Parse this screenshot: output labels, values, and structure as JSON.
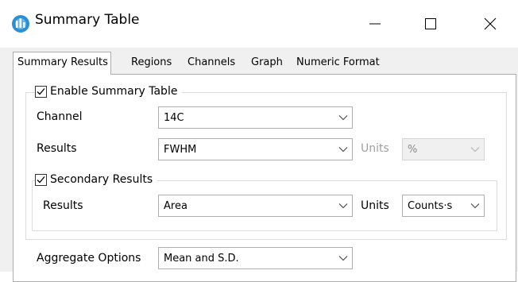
{
  "window": {
    "title": "Summary Table",
    "minimize_icon": "minimize-icon",
    "maximize_icon": "maximize-icon",
    "close_icon": "close-icon"
  },
  "tabs": [
    {
      "label": "Summary Results",
      "active": true
    },
    {
      "label": "Regions",
      "active": false
    },
    {
      "label": "Channels",
      "active": false
    },
    {
      "label": "Graph",
      "active": false
    },
    {
      "label": "Numeric Format",
      "active": false
    }
  ],
  "summary": {
    "enable_label": "Enable Summary Table",
    "enable_checked": true,
    "channel_label": "Channel",
    "channel_value": "14C",
    "results_label": "Results",
    "results_value": "FWHM",
    "units_label": "Units",
    "units_value": "%",
    "units_enabled": false
  },
  "secondary": {
    "label": "Secondary Results",
    "checked": true,
    "results_label": "Results",
    "results_value": "Area",
    "units_label": "Units",
    "units_value": "Counts·s"
  },
  "aggregate": {
    "label": "Aggregate Options",
    "value": "Mean and S.D."
  },
  "colors": {
    "accent": "#1e7fc6",
    "border": "#adadad",
    "disabled_text": "#a0a0a0"
  }
}
